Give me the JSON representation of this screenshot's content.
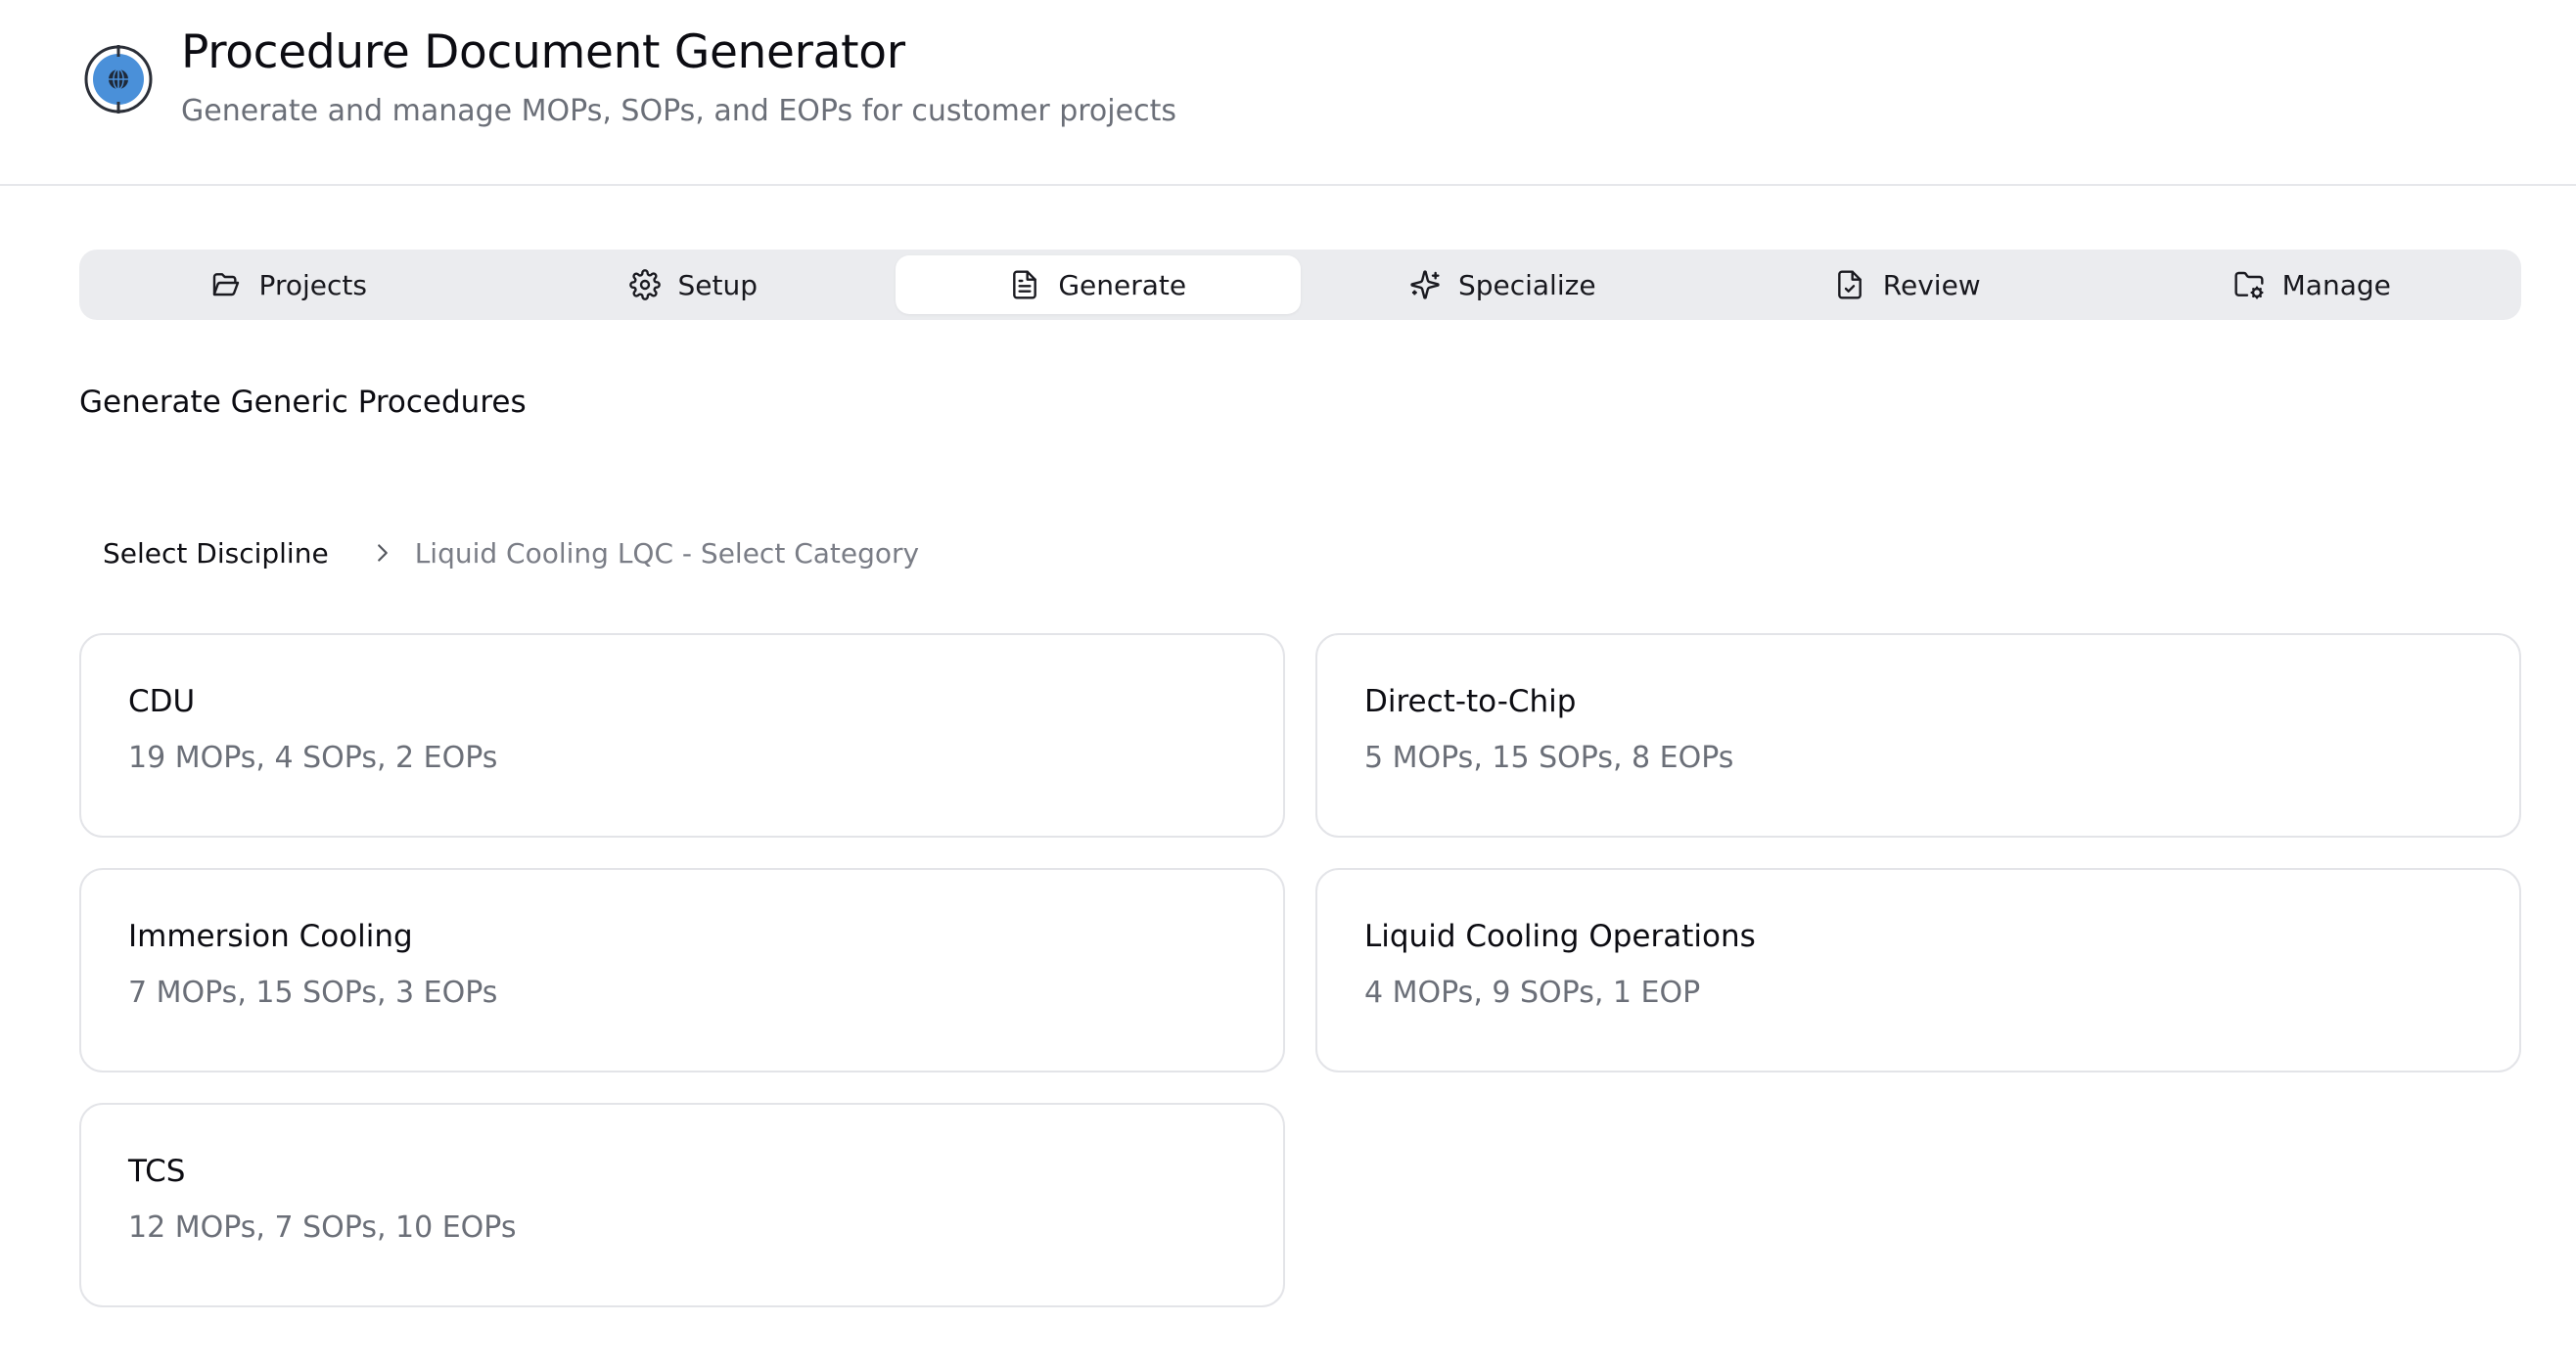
{
  "header": {
    "title": "Procedure Document Generator",
    "subtitle": "Generate and manage MOPs, SOPs, and EOPs for customer projects",
    "logo_icon": "globe-target-icon",
    "logo_color": "#4a90d9"
  },
  "tabs": [
    {
      "label": "Projects",
      "icon": "folder-open-icon"
    },
    {
      "label": "Setup",
      "icon": "gear-icon"
    },
    {
      "label": "Generate",
      "icon": "document-icon",
      "active": true
    },
    {
      "label": "Specialize",
      "icon": "sparkles-icon"
    },
    {
      "label": "Review",
      "icon": "document-check-icon"
    },
    {
      "label": "Manage",
      "icon": "folder-gear-icon"
    }
  ],
  "section": {
    "title": "Generate Generic Procedures"
  },
  "breadcrumb": {
    "root": "Select Discipline",
    "current": "Liquid Cooling LQC - Select Category"
  },
  "categories": [
    {
      "name": "CDU",
      "counts": "19 MOPs, 4 SOPs, 2 EOPs"
    },
    {
      "name": "Direct-to-Chip",
      "counts": "5 MOPs, 15 SOPs, 8 EOPs"
    },
    {
      "name": "Immersion Cooling",
      "counts": "7 MOPs, 15 SOPs, 3 EOPs"
    },
    {
      "name": "Liquid Cooling Operations",
      "counts": "4 MOPs, 9 SOPs, 1 EOP"
    },
    {
      "name": "TCS",
      "counts": "12 MOPs, 7 SOPs, 10 EOPs"
    }
  ]
}
